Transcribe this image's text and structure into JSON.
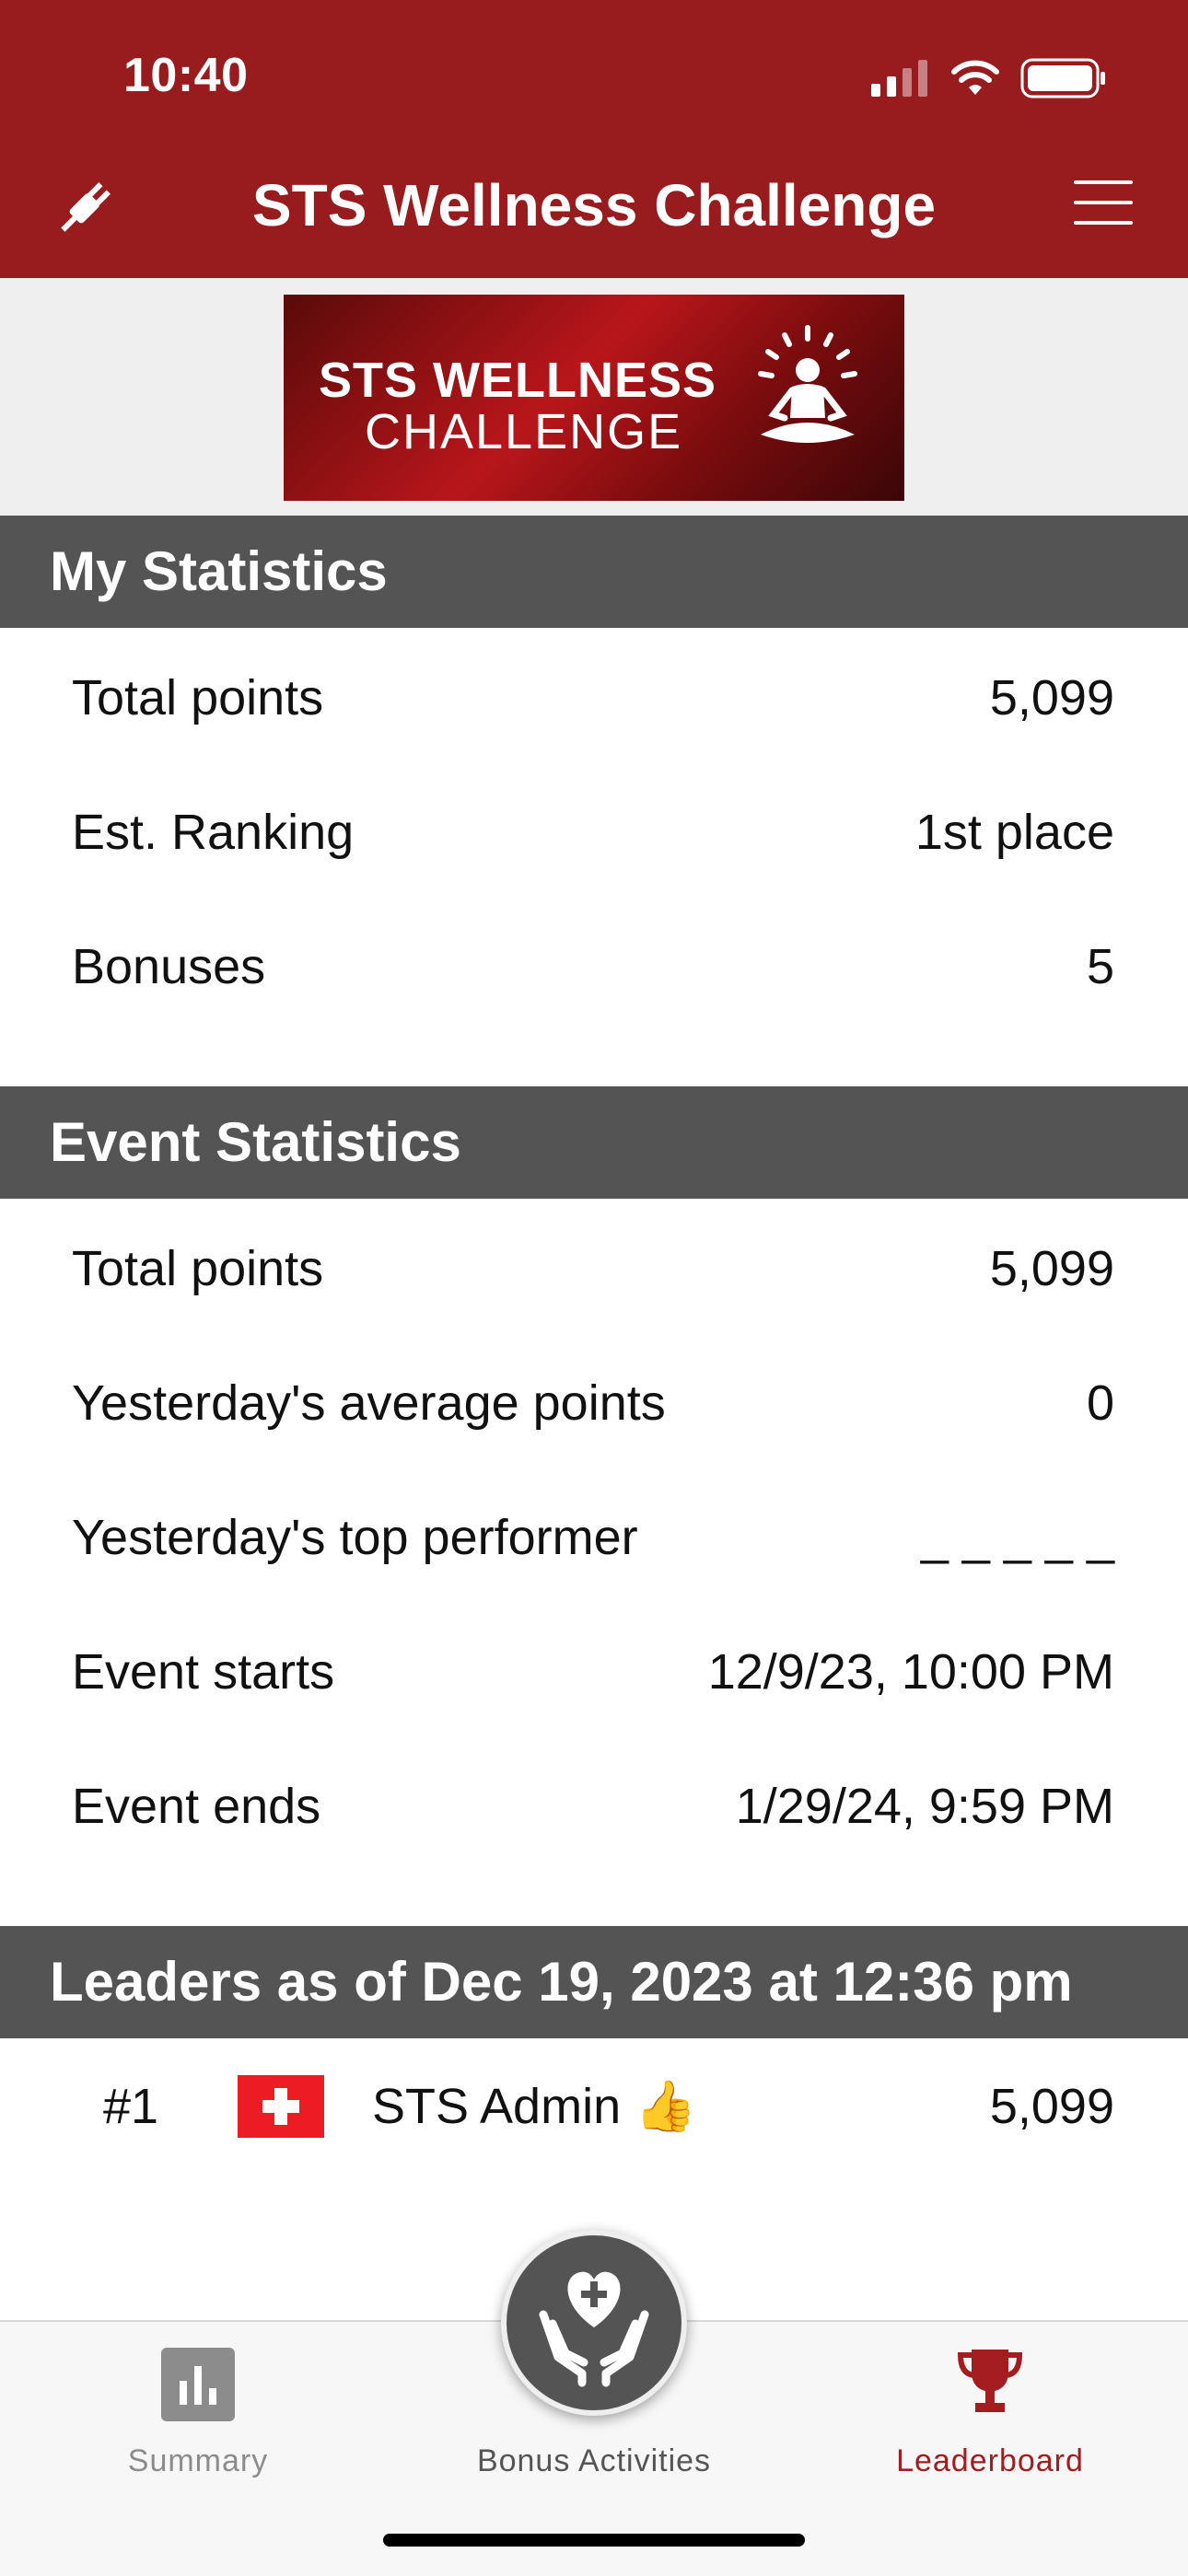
{
  "status_bar": {
    "time": "10:40"
  },
  "header": {
    "title": "STS Wellness Challenge"
  },
  "banner": {
    "line1": "STS WELLNESS",
    "line2": "CHALLENGE"
  },
  "my_statistics": {
    "title": "My Statistics",
    "rows": [
      {
        "label": "Total points",
        "value": "5,099"
      },
      {
        "label": "Est. Ranking",
        "value": "1st place"
      },
      {
        "label": "Bonuses",
        "value": "5"
      }
    ]
  },
  "event_statistics": {
    "title": "Event Statistics",
    "rows": [
      {
        "label": "Total points",
        "value": "5,099"
      },
      {
        "label": "Yesterday's average points",
        "value": "0"
      },
      {
        "label": "Yesterday's top performer",
        "value": "_ _ _ _ _"
      },
      {
        "label": "Event starts",
        "value": "12/9/23, 10:00 PM"
      },
      {
        "label": "Event ends",
        "value": "1/29/24, 9:59 PM"
      }
    ]
  },
  "leaders": {
    "title": "Leaders as of Dec 19, 2023 at 12:36 pm",
    "entries": [
      {
        "rank": "#1",
        "name": "STS Admin 👍",
        "points": "5,099",
        "flag": "switzerland-flag"
      }
    ]
  },
  "tabbar": {
    "tabs": [
      {
        "label": "Summary",
        "icon": "bar-chart-icon",
        "active": false
      },
      {
        "label": "Bonus Activities",
        "icon": "heart-hands-icon",
        "active": false
      },
      {
        "label": "Leaderboard",
        "icon": "trophy-icon",
        "active": true
      }
    ]
  },
  "colors": {
    "brand_red": "#981b1e",
    "section_gray": "#545454",
    "active_tab": "#a31c1f",
    "inactive_tab": "#8c8c8c"
  }
}
